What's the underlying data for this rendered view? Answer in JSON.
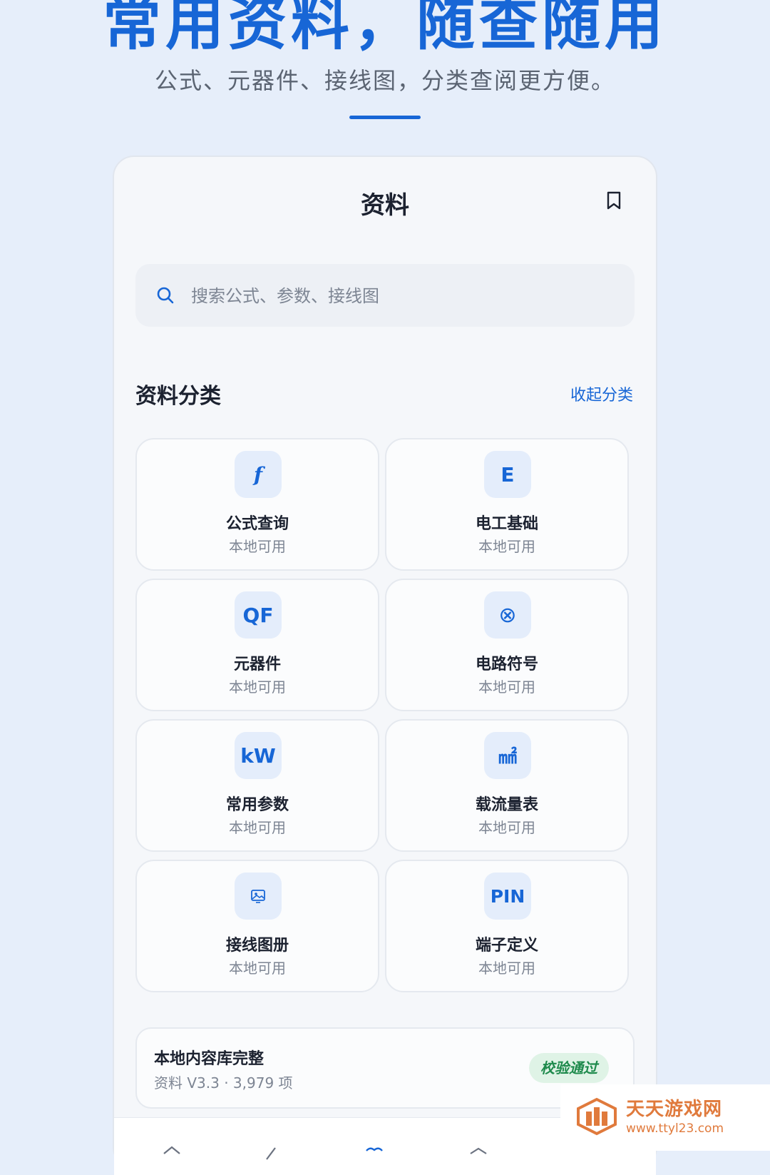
{
  "hero": {
    "title": "常用资料，随查随用",
    "subtitle": "公式、元器件、接线图，分类查阅更方便。"
  },
  "screen": {
    "title": "资料",
    "bookmark_icon": "bookmark-icon"
  },
  "search": {
    "placeholder": "搜索公式、参数、接线图",
    "value": ""
  },
  "categories_section": {
    "title": "资料分类",
    "collapse_label": "收起分类"
  },
  "categories": [
    {
      "icon": "f",
      "name": "公式查询",
      "status": "本地可用"
    },
    {
      "icon": "E",
      "name": "电工基础",
      "status": "本地可用"
    },
    {
      "icon": "QF",
      "name": "元器件",
      "status": "本地可用"
    },
    {
      "icon": "⊗",
      "name": "电路符号",
      "status": "本地可用"
    },
    {
      "icon": "kW",
      "name": "常用参数",
      "status": "本地可用"
    },
    {
      "icon": "㎟",
      "name": "载流量表",
      "status": "本地可用"
    },
    {
      "icon": "image-icon",
      "name": "接线图册",
      "status": "本地可用"
    },
    {
      "icon": "PIN",
      "name": "端子定义",
      "status": "本地可用"
    }
  ],
  "library": {
    "title": "本地内容库完整",
    "meta": "资料 V3.3 · 3,979 项",
    "badge": "校验通过"
  },
  "tabbar": {
    "icons": [
      "home-icon",
      "edit-icon",
      "library-icon",
      "profile-icon"
    ]
  },
  "watermark": {
    "name": "天天游戏网",
    "url": "www.ttyl23.com"
  },
  "colors": {
    "accent": "#1766d6",
    "background": "#e6eefa",
    "success": "#1e8a4c"
  }
}
